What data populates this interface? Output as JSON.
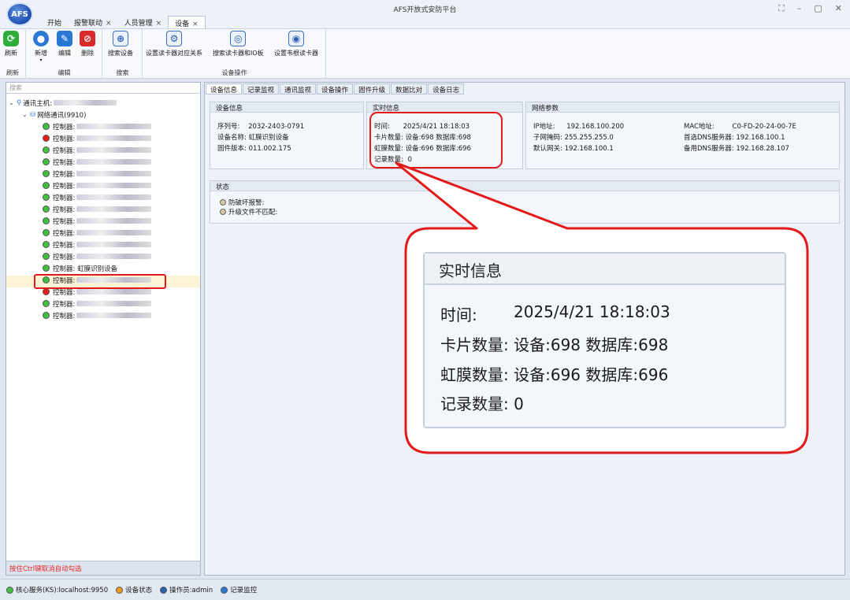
{
  "window": {
    "logo_text": "AFS",
    "title": "AFS开放式安防平台",
    "controls": [
      "⛶",
      "–",
      "▢",
      "✕"
    ]
  },
  "tabs": [
    {
      "label": "开始",
      "closable": false
    },
    {
      "label": "报警联动",
      "closable": true
    },
    {
      "label": "人员管理",
      "closable": true
    },
    {
      "label": "设备",
      "closable": true,
      "active": true
    }
  ],
  "ribbon": {
    "groups": [
      {
        "label": "刷新",
        "buttons": [
          {
            "label": "刷新",
            "icon": "refresh-icon"
          }
        ]
      },
      {
        "label": "编辑",
        "buttons": [
          {
            "label": "新增",
            "icon": "add-icon"
          },
          {
            "label": "编辑",
            "icon": "edit-icon"
          },
          {
            "label": "删除",
            "icon": "delete-icon"
          }
        ]
      },
      {
        "label": "搜索",
        "buttons": [
          {
            "label": "搜索设备",
            "icon": "search-device-icon"
          }
        ]
      },
      {
        "label": "设备操作",
        "buttons": [
          {
            "label": "设置读卡器对应关系",
            "icon": "reader-mapping-icon"
          },
          {
            "label": "搜索读卡器和IO板",
            "icon": "search-reader-icon"
          },
          {
            "label": "设置韦根读卡器",
            "icon": "wiegand-icon"
          }
        ]
      }
    ]
  },
  "left_panel": {
    "search_placeholder": "搜索",
    "root_label": "通讯主机:",
    "network_label": "网络通讯(9910)",
    "controller_prefix": "控制器:",
    "selected_controller": "控制器: 虹膜识别设备",
    "controllers": [
      {
        "status": "online"
      },
      {
        "status": "offline"
      },
      {
        "status": "online"
      },
      {
        "status": "online"
      },
      {
        "status": "online"
      },
      {
        "status": "online"
      },
      {
        "status": "online"
      },
      {
        "status": "online"
      },
      {
        "status": "online"
      },
      {
        "status": "online"
      },
      {
        "status": "online"
      },
      {
        "status": "online"
      },
      {
        "status": "online",
        "selected": true
      },
      {
        "status": "online"
      },
      {
        "status": "offline"
      },
      {
        "status": "online"
      },
      {
        "status": "online"
      }
    ],
    "hint": "按住Ctrl键取消自动勾选"
  },
  "right_tabs": [
    "设备信息",
    "记录监视",
    "通讯监视",
    "设备操作",
    "固件升级",
    "数据比对",
    "设备日志"
  ],
  "device_info": {
    "title": "设备信息",
    "serial_label": "序列号:",
    "serial": "2032-2403-0791",
    "name_label": "设备名称:",
    "name": "虹膜识别设备",
    "firmware_label": "固件版本:",
    "firmware": "011.002.175"
  },
  "realtime": {
    "title": "实时信息",
    "time_label": "时间:",
    "time": "2025/4/21 18:18:03",
    "card_label": "卡片数量:",
    "card": "设备:698 数据库:698",
    "iris_label": "虹膜数量:",
    "iris": "设备:696 数据库:696",
    "record_label": "记录数量:",
    "record": "0"
  },
  "network": {
    "title": "网络参数",
    "ip_label": "IP地址:",
    "ip": "192.168.100.200",
    "mask_label": "子网掩码:",
    "mask": "255.255.255.0",
    "gateway_label": "默认网关:",
    "gateway": "192.168.100.1",
    "mac_label": "MAC地址:",
    "mac": "C0-FD-20-24-00-7E",
    "dns1_label": "首选DNS服务器:",
    "dns1": "192.168.100.1",
    "dns2_label": "备用DNS服务器:",
    "dns2": "192.168.28.107"
  },
  "status_box": {
    "title": "状态",
    "items": [
      "防破坏报警:",
      "升级文件不匹配:"
    ]
  },
  "statusbar": {
    "items": [
      {
        "label": "核心服务(KS):localhost:9950",
        "color": "#3fc13f"
      },
      {
        "label": "设备状态",
        "color": "#f39a1d"
      },
      {
        "label": "操作员:admin",
        "color": "#2b5fb0"
      },
      {
        "label": "记录监控",
        "color": "#2b78d4"
      }
    ]
  },
  "colors": {
    "online": "#3fc13f",
    "offline": "#e31b1b",
    "highlight": "#e21a1a"
  }
}
